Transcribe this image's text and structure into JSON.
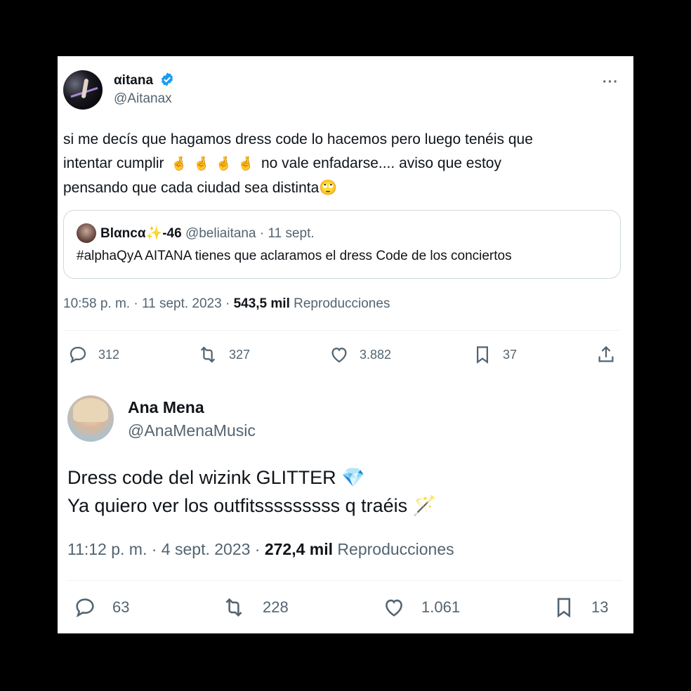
{
  "tweet1": {
    "name": "αitana",
    "handle": "@Aitanax",
    "more": "···",
    "text_line1": "si me decís que hagamos dress code lo hacemos pero luego tenéis que",
    "text_line2a": "intentar cumplir",
    "emoji_crossed": "🤞",
    "text_line2b": "no vale enfadarse.... aviso que estoy",
    "text_line3": "pensando que cada ciudad sea distinta",
    "emoji_eyeroll": "🙄",
    "quote": {
      "name": "Blαncα✨-46",
      "meta": "@beliaitana · 11 sept.",
      "text": "#alphaQyA AITANA tienes que aclaramos el dress Code de los conciertos"
    },
    "timestamp": "10:58 p. m. · 11 sept. 2023 · ",
    "views": "543,5 mil",
    "views_label": "Reproducciones",
    "replies": "312",
    "retweets": "327",
    "likes": "3.882",
    "bookmarks": "37"
  },
  "tweet2": {
    "name": "Ana Mena",
    "handle": "@AnaMenaMusic",
    "text_line1": "Dress code del wizink GLITTER",
    "emoji_gem": "💎",
    "text_line2": "Ya quiero ver los outfitsssssssss q traéis",
    "emoji_wand": "🪄",
    "timestamp": "11:12 p. m. · 4 sept. 2023 · ",
    "views": "272,4 mil",
    "views_label": "Reproducciones",
    "replies": "63",
    "retweets": "228",
    "likes": "1.061",
    "bookmarks": "13"
  },
  "colors": {
    "verified": "#1d9bf0",
    "secondary_text": "#536471",
    "border": "#cfd9de"
  }
}
